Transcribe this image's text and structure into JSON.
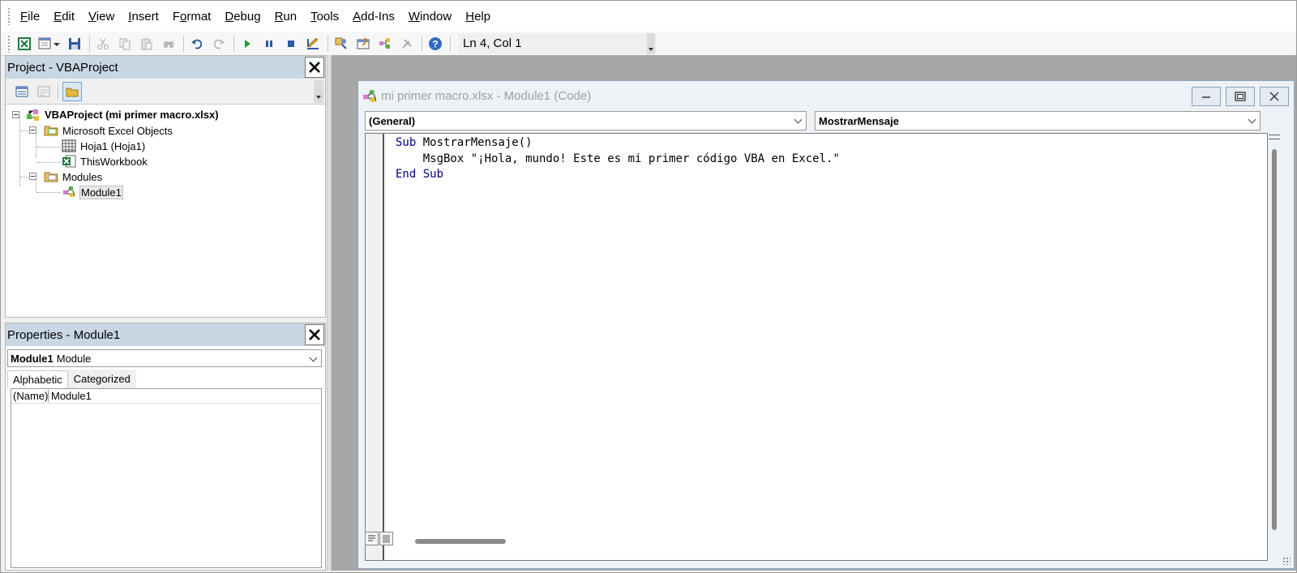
{
  "menubar": {
    "items": [
      {
        "pre": "",
        "u": "F",
        "post": "ile"
      },
      {
        "pre": "",
        "u": "E",
        "post": "dit"
      },
      {
        "pre": "",
        "u": "V",
        "post": "iew"
      },
      {
        "pre": "",
        "u": "I",
        "post": "nsert"
      },
      {
        "pre": "F",
        "u": "o",
        "post": "rmat"
      },
      {
        "pre": "",
        "u": "D",
        "post": "ebug"
      },
      {
        "pre": "",
        "u": "R",
        "post": "un"
      },
      {
        "pre": "",
        "u": "T",
        "post": "ools"
      },
      {
        "pre": "",
        "u": "A",
        "post": "dd-Ins"
      },
      {
        "pre": "",
        "u": "W",
        "post": "indow"
      },
      {
        "pre": "",
        "u": "H",
        "post": "elp"
      }
    ]
  },
  "toolbar": {
    "cursor_position": "Ln 4, Col 1",
    "icons": [
      "view-excel-icon",
      "insert-module-icon",
      "save-icon",
      "cut-icon",
      "copy-icon",
      "paste-icon",
      "find-icon",
      "undo-icon",
      "redo-icon",
      "run-icon",
      "break-icon",
      "reset-icon",
      "design-mode-icon",
      "project-explorer-icon",
      "properties-icon",
      "object-browser-icon",
      "toolbox-icon",
      "help-icon"
    ]
  },
  "project": {
    "title": "Project - VBAProject",
    "tree": {
      "root": "VBAProject (mi primer macro.xlsx)",
      "excel_objects": "Microsoft Excel Objects",
      "sheet1": "Hoja1 (Hoja1)",
      "workbook": "ThisWorkbook",
      "modules": "Modules",
      "module1": "Module1"
    }
  },
  "properties": {
    "title": "Properties - Module1",
    "object_name": "Module1",
    "object_type": "Module",
    "tabs": [
      "Alphabetic",
      "Categorized"
    ],
    "rows": [
      {
        "name": "(Name)",
        "value": "Module1"
      }
    ]
  },
  "code_window": {
    "title": "mi primer macro.xlsx - Module1 (Code)",
    "object_combo": "(General)",
    "procedure_combo": "MostrarMensaje",
    "lines": [
      {
        "kw": "Sub",
        "rest": " MostrarMensaje()"
      },
      {
        "kw": "",
        "rest": "    MsgBox \"¡Hola, mundo! Este es mi primer código VBA en Excel.\""
      },
      {
        "kw": "End Sub",
        "rest": ""
      }
    ]
  },
  "colors": {
    "pane_title_bg": "#c9d6e4",
    "keyword": "#00007f",
    "mdi_bg": "#a7a7a7"
  }
}
